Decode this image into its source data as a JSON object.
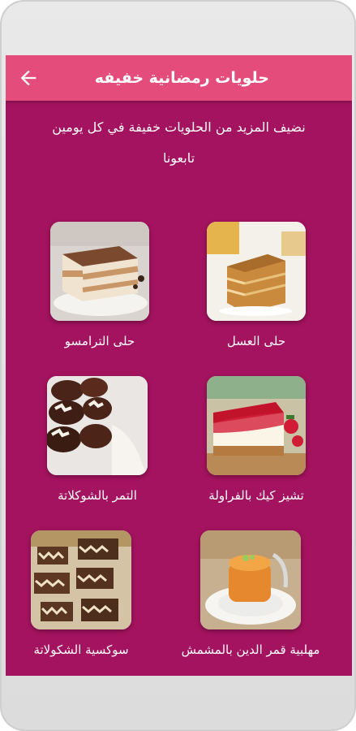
{
  "appbar": {
    "title": "حلويات رمضانية خفيفه",
    "back_icon": "arrow-back-icon"
  },
  "intro": {
    "line1": "نضيف المزيد من الحلويات خفيفة في كل يومين",
    "line2": "تابعونا"
  },
  "recipes": [
    {
      "label": "حلى العسل",
      "image": "honey-cake-image"
    },
    {
      "label": "حلى الترامسو",
      "image": "tiramisu-image"
    },
    {
      "label": "تشيز كيك بالفراولة",
      "image": "strawberry-cheesecake-image"
    },
    {
      "label": "التمر بالشوكلاتة",
      "image": "chocolate-dates-image"
    },
    {
      "label": "مهلبية قمر الدين بالمشمش",
      "image": "apricot-pudding-image"
    },
    {
      "label": "سوكسية الشكولاتة",
      "image": "chocolate-bars-image"
    }
  ],
  "colors": {
    "background": "#a4135f",
    "appbar": "#e44c7c",
    "text": "#ffffff"
  }
}
